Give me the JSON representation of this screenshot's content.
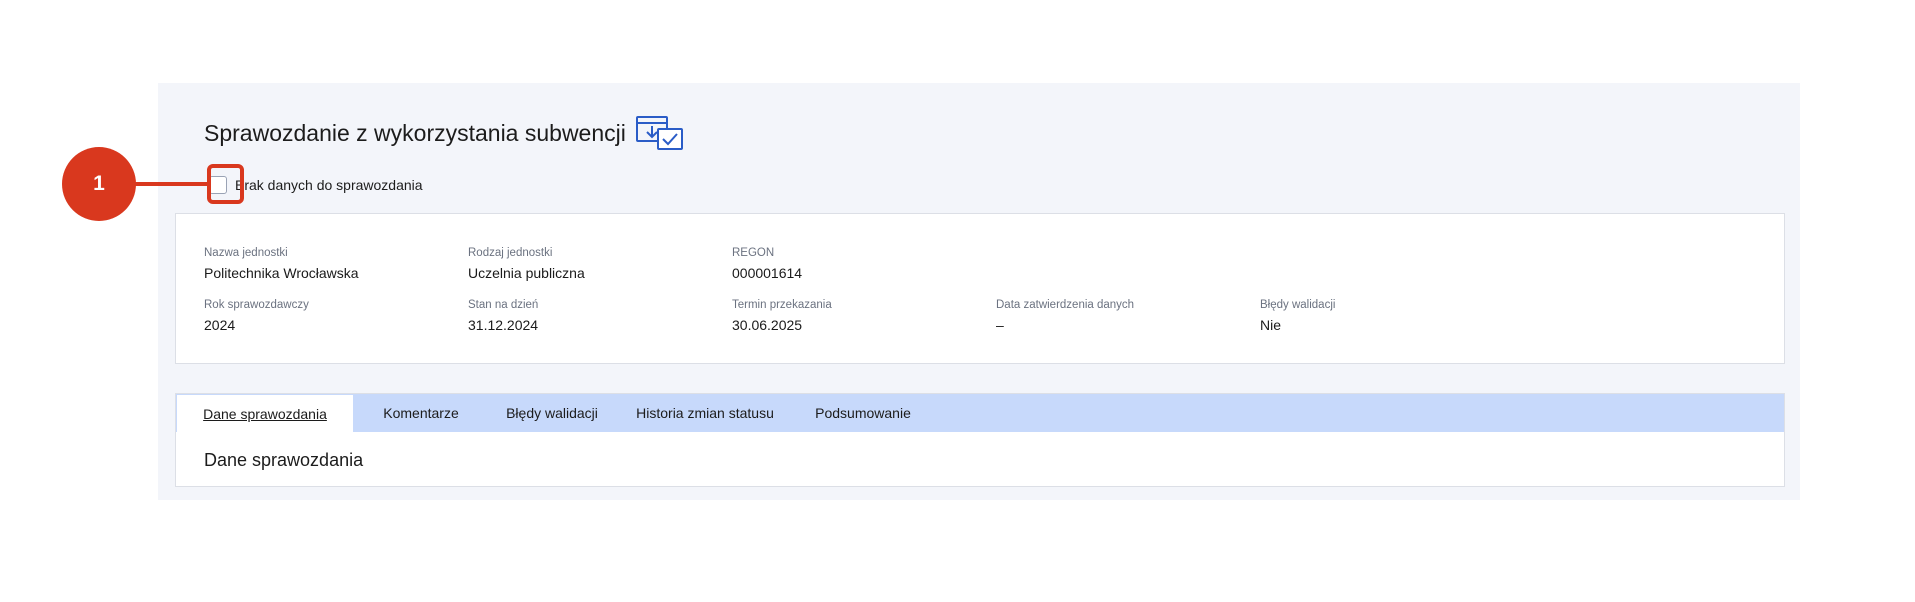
{
  "header": {
    "title": "Sprawozdanie z wykorzystania subwencji",
    "icon": "download-checklist-icon"
  },
  "no_data_checkbox": {
    "label": "Brak danych do sprawozdania",
    "checked": false
  },
  "info": {
    "row1": [
      {
        "label": "Nazwa jednostki",
        "value": "Politechnika Wrocławska"
      },
      {
        "label": "Rodzaj jednostki",
        "value": "Uczelnia publiczna"
      },
      {
        "label": "REGON",
        "value": "000001614"
      }
    ],
    "row2": [
      {
        "label": "Rok sprawozdawczy",
        "value": "2024"
      },
      {
        "label": "Stan na dzień",
        "value": "31.12.2024"
      },
      {
        "label": "Termin przekazania",
        "value": "30.06.2025"
      },
      {
        "label": "Data zatwierdzenia danych",
        "value": "–"
      },
      {
        "label": "Błędy walidacji",
        "value": "Nie"
      }
    ]
  },
  "tabs": [
    {
      "label": "Dane sprawozdania",
      "active": true
    },
    {
      "label": "Komentarze",
      "active": false
    },
    {
      "label": "Błędy walidacji",
      "active": false
    },
    {
      "label": "Historia zmian statusu",
      "active": false
    },
    {
      "label": "Podsumowanie",
      "active": false
    }
  ],
  "section": {
    "title": "Dane sprawozdania"
  },
  "annotation": {
    "badge": "1"
  },
  "colors": {
    "accent": "#d9381e",
    "tab_bar": "#c7d9fb",
    "panel": "#f3f5fa",
    "icon_blue": "#2a5cc7"
  }
}
